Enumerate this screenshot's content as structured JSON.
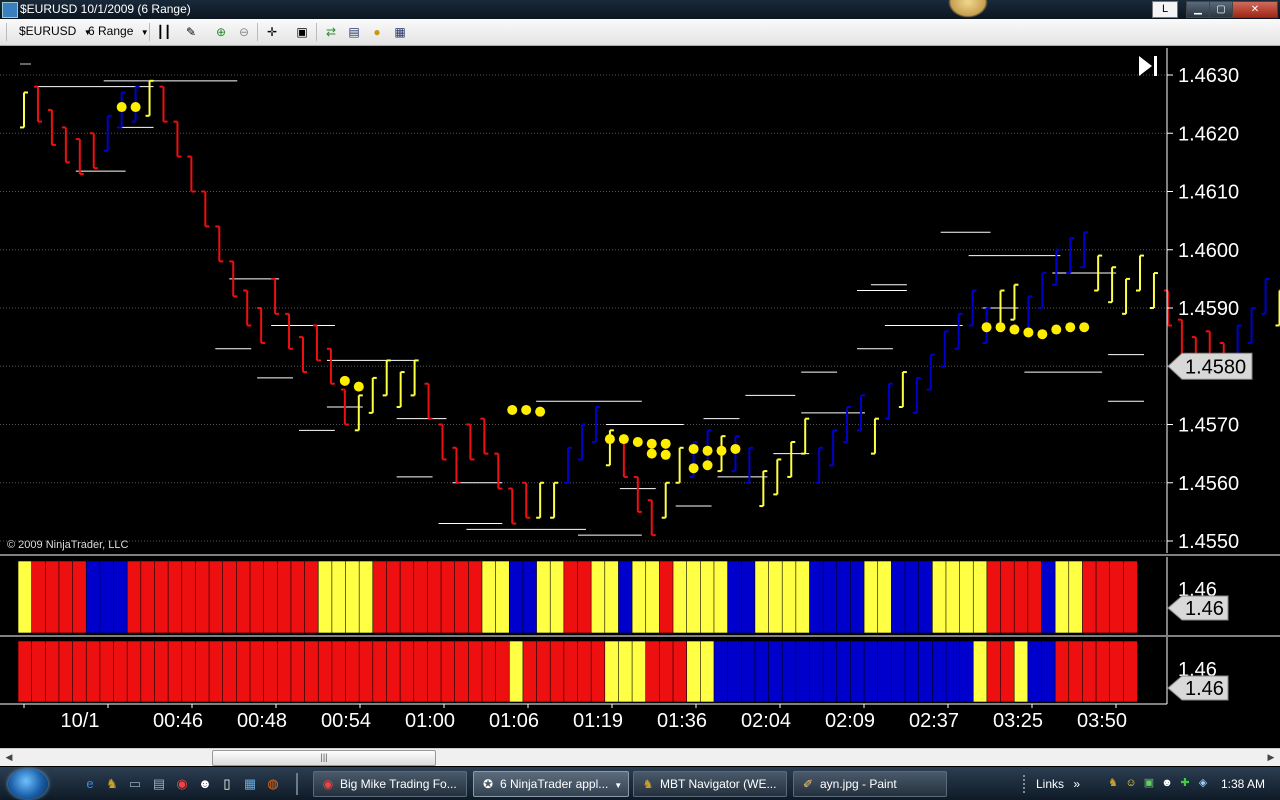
{
  "window": {
    "title": "$EURUSD  10/1/2009 (6 Range)",
    "button_l": "L",
    "btn_min": "▁",
    "btn_max": "▢",
    "btn_close": "✕"
  },
  "toolbar": {
    "instrument": "$EURUSD",
    "period": "6 Range"
  },
  "chart": {
    "copyright": "© 2009 NinjaTrader, LLC",
    "current_price_label": "1.4580",
    "indicator1_ticklabel": "1.46",
    "indicator1_value": "1.46",
    "indicator2_ticklabel": "1.46",
    "indicator2_value": "1.46"
  },
  "chart_data": {
    "type": "ohlc",
    "y_ticks": [
      "1.4630",
      "1.4620",
      "1.4610",
      "1.4600",
      "1.4590",
      "1.4580",
      "1.4570",
      "1.4560",
      "1.4550"
    ],
    "ylim": [
      1.4549,
      1.4633
    ],
    "x_labels": [
      "10/1",
      "00:46",
      "00:48",
      "00:54",
      "01:00",
      "01:06",
      "01:19",
      "01:36",
      "02:04",
      "02:09",
      "02:37",
      "03:25",
      "03:50"
    ],
    "colors": {
      "red": "#ee1010",
      "blue": "#0000cc",
      "yellow": "#ffff44",
      "background": "#000000",
      "grid": "#555555"
    },
    "bars": [
      {
        "h": 1.4627,
        "l": 1.4621,
        "c": "y"
      },
      {
        "h": 1.4628,
        "l": 1.4622,
        "c": "r"
      },
      {
        "h": 1.4624,
        "l": 1.4618,
        "c": "r"
      },
      {
        "h": 1.4621,
        "l": 1.4615,
        "c": "r"
      },
      {
        "h": 1.4619,
        "l": 1.4613,
        "c": "r"
      },
      {
        "h": 1.462,
        "l": 1.4614,
        "c": "r"
      },
      {
        "h": 1.4623,
        "l": 1.4617,
        "c": "b"
      },
      {
        "h": 1.4627,
        "l": 1.4621,
        "c": "b"
      },
      {
        "h": 1.4628,
        "l": 1.4622,
        "c": "b"
      },
      {
        "h": 1.4629,
        "l": 1.4623,
        "c": "y"
      },
      {
        "h": 1.4628,
        "l": 1.4622,
        "c": "r"
      },
      {
        "h": 1.4622,
        "l": 1.4616,
        "c": "r"
      },
      {
        "h": 1.4616,
        "l": 1.461,
        "c": "r"
      },
      {
        "h": 1.461,
        "l": 1.4604,
        "c": "r"
      },
      {
        "h": 1.4604,
        "l": 1.4598,
        "c": "r"
      },
      {
        "h": 1.4598,
        "l": 1.4592,
        "c": "r"
      },
      {
        "h": 1.4593,
        "l": 1.4587,
        "c": "r"
      },
      {
        "h": 1.459,
        "l": 1.4584,
        "c": "r"
      },
      {
        "h": 1.4595,
        "l": 1.4589,
        "c": "r"
      },
      {
        "h": 1.4589,
        "l": 1.4583,
        "c": "r"
      },
      {
        "h": 1.4585,
        "l": 1.4579,
        "c": "r"
      },
      {
        "h": 1.4587,
        "l": 1.4581,
        "c": "r"
      },
      {
        "h": 1.4583,
        "l": 1.4577,
        "c": "r"
      },
      {
        "h": 1.4576,
        "l": 1.457,
        "c": "r"
      },
      {
        "h": 1.4575,
        "l": 1.4569,
        "c": "y"
      },
      {
        "h": 1.4578,
        "l": 1.4572,
        "c": "y"
      },
      {
        "h": 1.4581,
        "l": 1.4575,
        "c": "y"
      },
      {
        "h": 1.4579,
        "l": 1.4573,
        "c": "y"
      },
      {
        "h": 1.4581,
        "l": 1.4575,
        "c": "y"
      },
      {
        "h": 1.4577,
        "l": 1.4571,
        "c": "r"
      },
      {
        "h": 1.457,
        "l": 1.4564,
        "c": "r"
      },
      {
        "h": 1.4566,
        "l": 1.456,
        "c": "r"
      },
      {
        "h": 1.457,
        "l": 1.4564,
        "c": "r"
      },
      {
        "h": 1.4571,
        "l": 1.4565,
        "c": "r"
      },
      {
        "h": 1.4565,
        "l": 1.4559,
        "c": "r"
      },
      {
        "h": 1.4559,
        "l": 1.4553,
        "c": "r"
      },
      {
        "h": 1.456,
        "l": 1.4554,
        "c": "r"
      },
      {
        "h": 1.456,
        "l": 1.4554,
        "c": "y"
      },
      {
        "h": 1.456,
        "l": 1.4554,
        "c": "y"
      },
      {
        "h": 1.4566,
        "l": 1.456,
        "c": "b"
      },
      {
        "h": 1.457,
        "l": 1.4564,
        "c": "b"
      },
      {
        "h": 1.4573,
        "l": 1.4567,
        "c": "b"
      },
      {
        "h": 1.4569,
        "l": 1.4563,
        "c": "y"
      },
      {
        "h": 1.4567,
        "l": 1.4561,
        "c": "r"
      },
      {
        "h": 1.4561,
        "l": 1.4555,
        "c": "r"
      },
      {
        "h": 1.4557,
        "l": 1.4551,
        "c": "r"
      },
      {
        "h": 1.456,
        "l": 1.4554,
        "c": "y"
      },
      {
        "h": 1.4566,
        "l": 1.456,
        "c": "y"
      },
      {
        "h": 1.4567,
        "l": 1.4561,
        "c": "b"
      },
      {
        "h": 1.4569,
        "l": 1.4563,
        "c": "b"
      },
      {
        "h": 1.4568,
        "l": 1.4562,
        "c": "y"
      },
      {
        "h": 1.4568,
        "l": 1.4562,
        "c": "b"
      },
      {
        "h": 1.4566,
        "l": 1.456,
        "c": "b"
      },
      {
        "h": 1.4562,
        "l": 1.4556,
        "c": "y"
      },
      {
        "h": 1.4564,
        "l": 1.4558,
        "c": "y"
      },
      {
        "h": 1.4567,
        "l": 1.4561,
        "c": "y"
      },
      {
        "h": 1.4571,
        "l": 1.4565,
        "c": "y"
      },
      {
        "h": 1.4566,
        "l": 1.456,
        "c": "b"
      },
      {
        "h": 1.4569,
        "l": 1.4563,
        "c": "b"
      },
      {
        "h": 1.4573,
        "l": 1.4567,
        "c": "b"
      },
      {
        "h": 1.4575,
        "l": 1.4569,
        "c": "b"
      },
      {
        "h": 1.4571,
        "l": 1.4565,
        "c": "y"
      },
      {
        "h": 1.4577,
        "l": 1.4571,
        "c": "b"
      },
      {
        "h": 1.4579,
        "l": 1.4573,
        "c": "y"
      },
      {
        "h": 1.4578,
        "l": 1.4572,
        "c": "b"
      },
      {
        "h": 1.4582,
        "l": 1.4576,
        "c": "b"
      },
      {
        "h": 1.4586,
        "l": 1.458,
        "c": "b"
      },
      {
        "h": 1.4589,
        "l": 1.4583,
        "c": "b"
      },
      {
        "h": 1.4593,
        "l": 1.4587,
        "c": "b"
      },
      {
        "h": 1.459,
        "l": 1.4584,
        "c": "b"
      },
      {
        "h": 1.4593,
        "l": 1.4587,
        "c": "y"
      },
      {
        "h": 1.4594,
        "l": 1.4588,
        "c": "y"
      },
      {
        "h": 1.4592,
        "l": 1.4586,
        "c": "b"
      },
      {
        "h": 1.4596,
        "l": 1.459,
        "c": "b"
      },
      {
        "h": 1.46,
        "l": 1.4594,
        "c": "b"
      },
      {
        "h": 1.4602,
        "l": 1.4596,
        "c": "b"
      },
      {
        "h": 1.4603,
        "l": 1.4597,
        "c": "b"
      },
      {
        "h": 1.4599,
        "l": 1.4593,
        "c": "y"
      },
      {
        "h": 1.4597,
        "l": 1.4591,
        "c": "y"
      },
      {
        "h": 1.4595,
        "l": 1.4589,
        "c": "y"
      },
      {
        "h": 1.4599,
        "l": 1.4593,
        "c": "y"
      },
      {
        "h": 1.4596,
        "l": 1.459,
        "c": "y"
      },
      {
        "h": 1.4593,
        "l": 1.4587,
        "c": "r"
      },
      {
        "h": 1.4588,
        "l": 1.4582,
        "c": "r"
      },
      {
        "h": 1.4585,
        "l": 1.4579,
        "c": "r"
      },
      {
        "h": 1.4586,
        "l": 1.458,
        "c": "r"
      },
      {
        "h": 1.4584,
        "l": 1.4578,
        "c": "r"
      },
      {
        "h": 1.4587,
        "l": 1.4581,
        "c": "b"
      },
      {
        "h": 1.459,
        "l": 1.4584,
        "c": "b"
      },
      {
        "h": 1.4595,
        "l": 1.4589,
        "c": "b"
      },
      {
        "h": 1.4593,
        "l": 1.4587,
        "c": "y"
      },
      {
        "h": 1.4586,
        "l": 1.458,
        "c": "r"
      },
      {
        "h": 1.4583,
        "l": 1.4577,
        "c": "r"
      },
      {
        "h": 1.458,
        "l": 1.4574,
        "c": "r"
      },
      {
        "h": 1.4582,
        "l": 1.4576,
        "c": "r"
      },
      {
        "h": 1.458,
        "l": 1.4574,
        "c": "r"
      }
    ],
    "dots": [
      {
        "bar": 7,
        "p": 1.46245
      },
      {
        "bar": 8,
        "p": 1.46245
      },
      {
        "bar": 23,
        "p": 1.45775
      },
      {
        "bar": 24,
        "p": 1.45765
      },
      {
        "bar": 35,
        "p": 1.45725
      },
      {
        "bar": 36,
        "p": 1.45725
      },
      {
        "bar": 37,
        "p": 1.45722
      },
      {
        "bar": 42,
        "p": 1.45675
      },
      {
        "bar": 43,
        "p": 1.45675
      },
      {
        "bar": 44,
        "p": 1.4567
      },
      {
        "bar": 45,
        "p": 1.45667
      },
      {
        "bar": 45,
        "p": 1.4565
      },
      {
        "bar": 46,
        "p": 1.45667
      },
      {
        "bar": 46,
        "p": 1.45648
      },
      {
        "bar": 48,
        "p": 1.45658
      },
      {
        "bar": 48,
        "p": 1.45625
      },
      {
        "bar": 49,
        "p": 1.45655
      },
      {
        "bar": 49,
        "p": 1.4563
      },
      {
        "bar": 50,
        "p": 1.45655
      },
      {
        "bar": 51,
        "p": 1.45658
      },
      {
        "bar": 69,
        "p": 1.45867
      },
      {
        "bar": 70,
        "p": 1.45867
      },
      {
        "bar": 71,
        "p": 1.45863
      },
      {
        "bar": 72,
        "p": 1.45858
      },
      {
        "bar": 73,
        "p": 1.45855
      },
      {
        "bar": 74,
        "p": 1.45863
      },
      {
        "bar": 75,
        "p": 1.45867
      },
      {
        "bar": 76,
        "p": 1.45867
      }
    ],
    "swing_lines": [
      {
        "p": 1.4628,
        "a": 1,
        "b": 9
      },
      {
        "p": 1.4629,
        "a": 6,
        "b": 15
      },
      {
        "p": 1.4621,
        "a": 7,
        "b": 9
      },
      {
        "p": 1.46135,
        "a": 4,
        "b": 7
      },
      {
        "p": 1.4595,
        "a": 15,
        "b": 18
      },
      {
        "p": 1.4587,
        "a": 18,
        "b": 22
      },
      {
        "p": 1.4583,
        "a": 14,
        "b": 16
      },
      {
        "p": 1.4578,
        "a": 17,
        "b": 19
      },
      {
        "p": 1.4581,
        "a": 22,
        "b": 28
      },
      {
        "p": 1.4573,
        "a": 22,
        "b": 24
      },
      {
        "p": 1.4569,
        "a": 20,
        "b": 22
      },
      {
        "p": 1.4571,
        "a": 27,
        "b": 30
      },
      {
        "p": 1.4561,
        "a": 27,
        "b": 29
      },
      {
        "p": 1.456,
        "a": 31,
        "b": 34
      },
      {
        "p": 1.4553,
        "a": 30,
        "b": 34
      },
      {
        "p": 1.4552,
        "a": 32,
        "b": 40
      },
      {
        "p": 1.4574,
        "a": 37,
        "b": 44
      },
      {
        "p": 1.4551,
        "a": 40,
        "b": 44
      },
      {
        "p": 1.457,
        "a": 42,
        "b": 47
      },
      {
        "p": 1.4559,
        "a": 43,
        "b": 45
      },
      {
        "p": 1.4556,
        "a": 47,
        "b": 49
      },
      {
        "p": 1.4571,
        "a": 49,
        "b": 51
      },
      {
        "p": 1.4561,
        "a": 50,
        "b": 53
      },
      {
        "p": 1.4575,
        "a": 52,
        "b": 55
      },
      {
        "p": 1.4565,
        "a": 54,
        "b": 56
      },
      {
        "p": 1.4579,
        "a": 56,
        "b": 58
      },
      {
        "p": 1.4572,
        "a": 56,
        "b": 60
      },
      {
        "p": 1.4593,
        "a": 60,
        "b": 63
      },
      {
        "p": 1.4583,
        "a": 60,
        "b": 62
      },
      {
        "p": 1.4594,
        "a": 61,
        "b": 63
      },
      {
        "p": 1.4587,
        "a": 62,
        "b": 67
      },
      {
        "p": 1.4603,
        "a": 66,
        "b": 69
      },
      {
        "p": 1.4599,
        "a": 68,
        "b": 74
      },
      {
        "p": 1.459,
        "a": 69,
        "b": 71
      },
      {
        "p": 1.4596,
        "a": 74,
        "b": 78
      },
      {
        "p": 1.4579,
        "a": 72,
        "b": 77
      },
      {
        "p": 1.4582,
        "a": 78,
        "b": 80
      },
      {
        "p": 1.4574,
        "a": 78,
        "b": 80
      }
    ],
    "indicator1": [
      "y",
      "r",
      "r",
      "r",
      "r",
      "b",
      "b",
      "b",
      "r",
      "r",
      "r",
      "r",
      "r",
      "r",
      "r",
      "r",
      "r",
      "r",
      "r",
      "r",
      "r",
      "r",
      "y",
      "y",
      "y",
      "y",
      "r",
      "r",
      "r",
      "r",
      "r",
      "r",
      "r",
      "r",
      "y",
      "y",
      "b",
      "b",
      "y",
      "y",
      "r",
      "r",
      "y",
      "y",
      "b",
      "y",
      "y",
      "r",
      "y",
      "y",
      "y",
      "y",
      "b",
      "b",
      "y",
      "y",
      "y",
      "y",
      "b",
      "b",
      "b",
      "b",
      "y",
      "y",
      "b",
      "b",
      "b",
      "y",
      "y",
      "y",
      "y",
      "r",
      "r",
      "r",
      "r",
      "b",
      "y",
      "y",
      "r",
      "r",
      "r",
      "r"
    ],
    "indicator2": [
      "r",
      "r",
      "r",
      "r",
      "r",
      "r",
      "r",
      "r",
      "r",
      "r",
      "r",
      "r",
      "r",
      "r",
      "r",
      "r",
      "r",
      "r",
      "r",
      "r",
      "r",
      "r",
      "r",
      "r",
      "r",
      "r",
      "r",
      "r",
      "r",
      "r",
      "r",
      "r",
      "r",
      "r",
      "r",
      "r",
      "y",
      "r",
      "r",
      "r",
      "r",
      "r",
      "r",
      "y",
      "y",
      "y",
      "r",
      "r",
      "r",
      "y",
      "y",
      "b",
      "b",
      "b",
      "b",
      "b",
      "b",
      "b",
      "b",
      "b",
      "b",
      "b",
      "b",
      "b",
      "b",
      "b",
      "b",
      "b",
      "b",
      "b",
      "y",
      "r",
      "r",
      "y",
      "b",
      "b",
      "r",
      "r",
      "r",
      "r",
      "r",
      "r"
    ]
  },
  "scrollbar": {
    "grip": "|||",
    "left_arrow": "◀",
    "right_arrow": "▶"
  },
  "taskbar": {
    "tasks": [
      {
        "label": "Big Mike Trading Fo..."
      },
      {
        "label": "6 NinjaTrader appl..."
      },
      {
        "label": "MBT Navigator (WE..."
      },
      {
        "label": "ayn.jpg - Paint"
      }
    ],
    "links": "Links",
    "links_chevron": "»",
    "clock": "1:38 AM"
  }
}
